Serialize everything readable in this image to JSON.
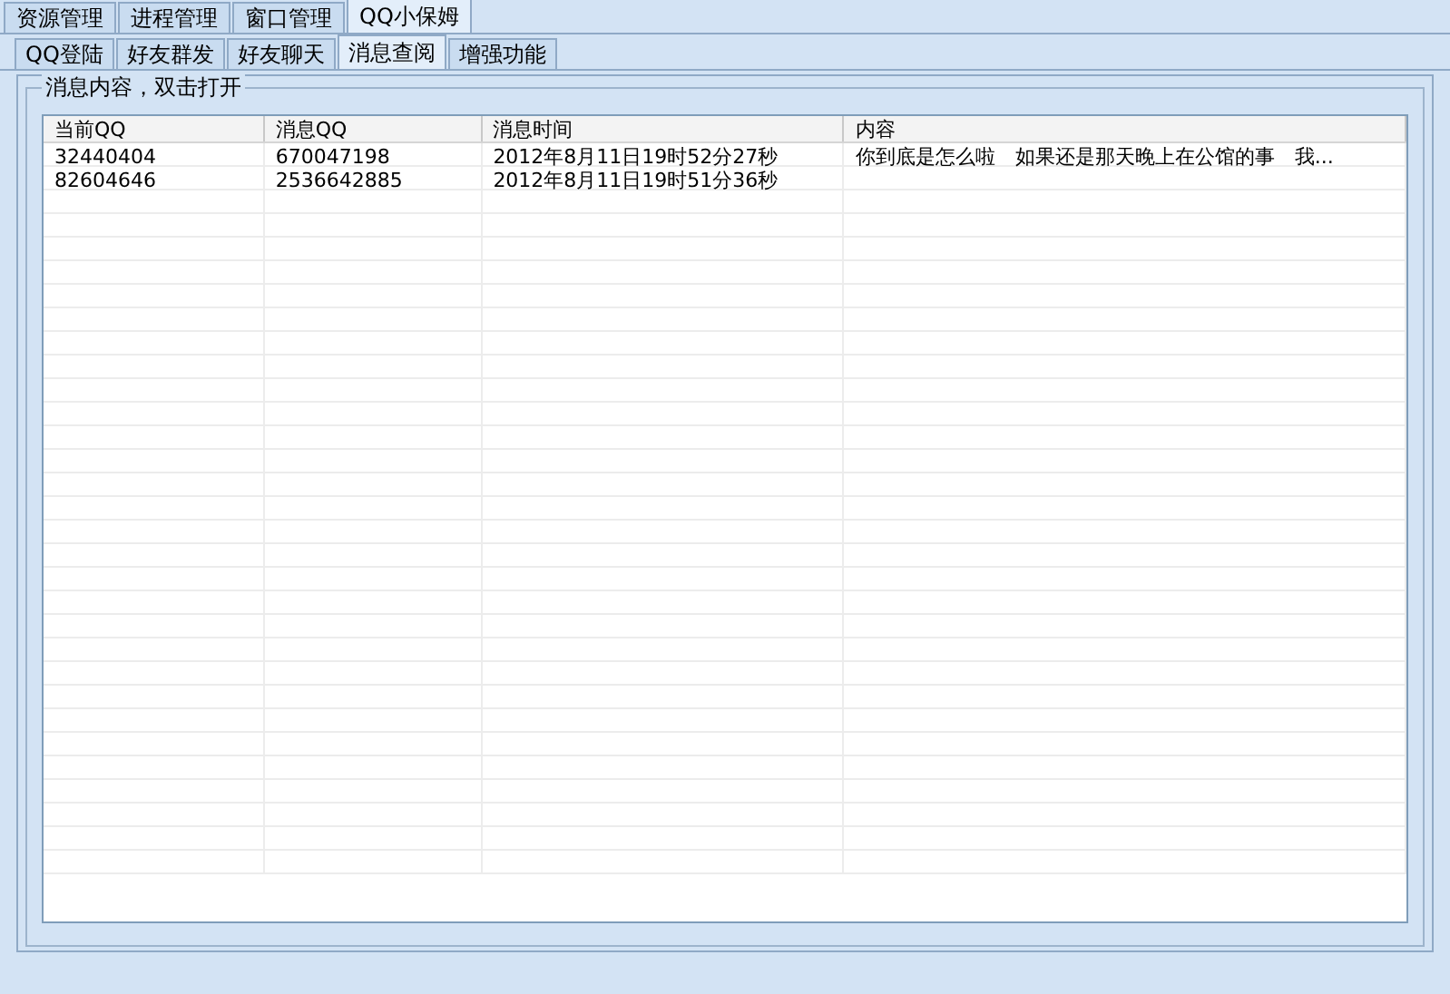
{
  "main_tabs": [
    {
      "label": "资源管理",
      "selected": false
    },
    {
      "label": "进程管理",
      "selected": false
    },
    {
      "label": "窗口管理",
      "selected": false
    },
    {
      "label": "QQ小保姆",
      "selected": true
    }
  ],
  "sub_tabs": [
    {
      "label": "QQ登陆",
      "selected": false
    },
    {
      "label": "好友群发",
      "selected": false
    },
    {
      "label": "好友聊天",
      "selected": false
    },
    {
      "label": "消息查阅",
      "selected": true
    },
    {
      "label": "增强功能",
      "selected": false
    }
  ],
  "group": {
    "title": "消息内容，双击打开"
  },
  "table": {
    "columns": [
      "当前QQ",
      "消息QQ",
      "消息时间",
      "内容"
    ],
    "rows": [
      [
        "32440404",
        "670047198",
        "2012年8月11日19时52分27秒",
        "你到底是怎么啦　如果还是那天晚上在公馆的事　我..."
      ],
      [
        "82604646",
        "2536642885",
        "2012年8月11日19时51分36秒",
        ""
      ]
    ]
  }
}
